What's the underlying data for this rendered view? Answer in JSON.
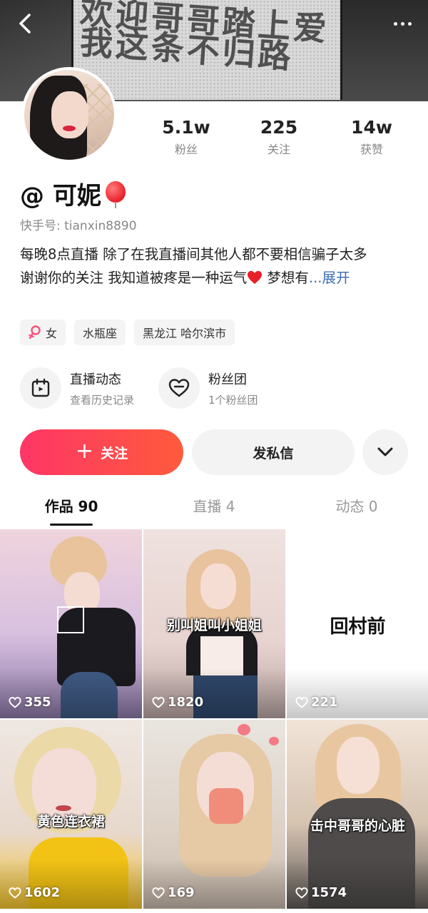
{
  "header": {
    "banner_text_line1": "欢迎哥哥踏上爱",
    "banner_text_line2": "我这条不归路"
  },
  "stats": [
    {
      "value": "5.1w",
      "label": "粉丝"
    },
    {
      "value": "225",
      "label": "关注"
    },
    {
      "value": "14w",
      "label": "获赞"
    }
  ],
  "profile": {
    "name": "@ 可妮",
    "kuaishou_id": "快手号: tianxin8890",
    "bio_line1": "每晚8点直播  除了在我直播间其他人都不要相信骗子太多",
    "bio_line2_before": "谢谢你的关注  我知道被疼是一种运气",
    "bio_line2_after": "  梦想有",
    "bio_expand": "...展开",
    "tags": [
      "女",
      "水瓶座",
      "黑龙江  哈尔滨市"
    ]
  },
  "entries": [
    {
      "title": "直播动态",
      "subtitle": "查看历史记录"
    },
    {
      "title": "粉丝团",
      "subtitle": "1个粉丝团"
    }
  ],
  "actions": {
    "follow": "关注",
    "message": "发私信"
  },
  "tabs": [
    {
      "label": "作品 90",
      "active": true
    },
    {
      "label": "直播 4",
      "active": false
    },
    {
      "label": "动态 0",
      "active": false
    }
  ],
  "videos": [
    {
      "likes": "355",
      "caption": ""
    },
    {
      "likes": "1820",
      "caption": "别叫姐叫小姐姐"
    },
    {
      "likes": "221",
      "caption": "回村前"
    },
    {
      "likes": "1602",
      "caption": "黄色连衣裙"
    },
    {
      "likes": "169",
      "caption": ""
    },
    {
      "likes": "1574",
      "caption": "击中哥哥的心脏"
    }
  ],
  "colors": {
    "follow_gradient_start": "#fe3666",
    "follow_gradient_end": "#ff5a3c",
    "expand_link": "#3a6bb0"
  }
}
